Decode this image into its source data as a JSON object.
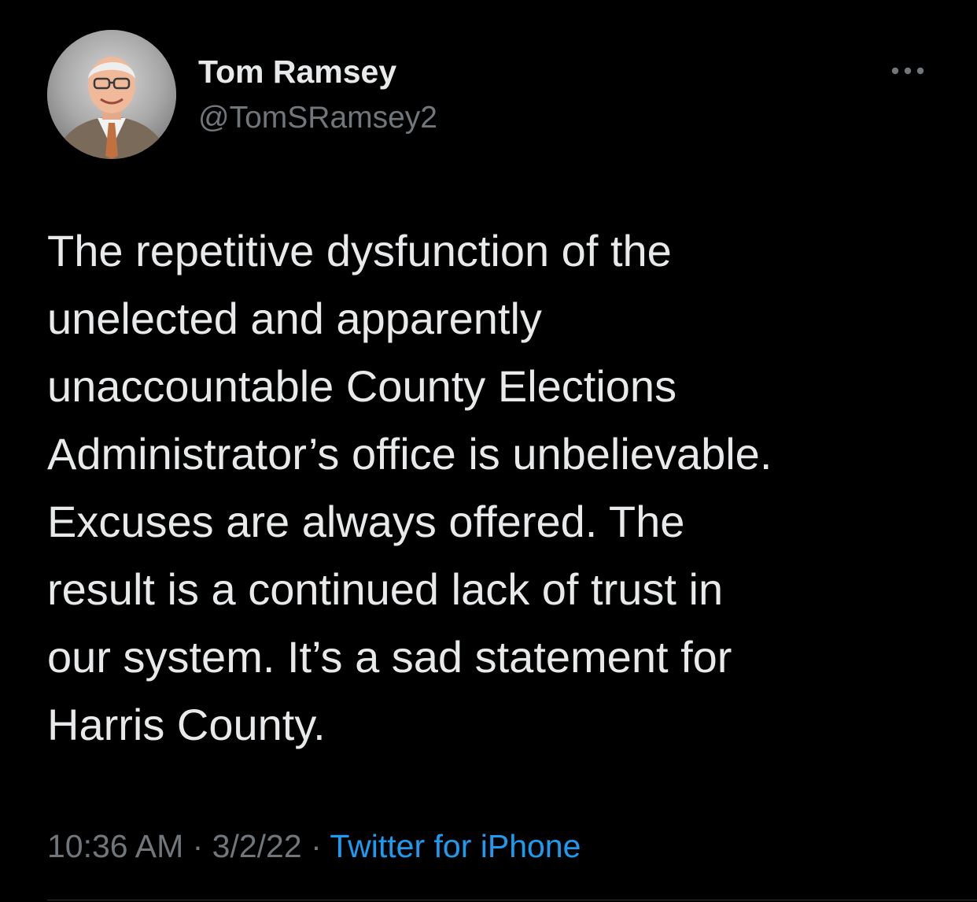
{
  "author": {
    "display_name": "Tom Ramsey",
    "handle": "@TomSRamsey2",
    "avatar_icon": "profile-photo"
  },
  "more_icon": "more-horizontal-icon",
  "tweet": {
    "lines": [
      "The repetitive dysfunction of the",
      "unelected and apparently",
      "unaccountable County Elections",
      "Administrator’s office is unbelievable.",
      "Excuses are always offered. The",
      "result is a continued lack of trust in",
      "our system. It’s a sad statement for",
      "Harris County."
    ]
  },
  "meta": {
    "time": "10:36 AM",
    "separator": " · ",
    "date": "3/2/22",
    "source": "Twitter for iPhone"
  },
  "colors": {
    "background": "#000000",
    "primary_text": "#e7e9ea",
    "secondary_text": "#71767b",
    "link": "#1d9bf0"
  }
}
